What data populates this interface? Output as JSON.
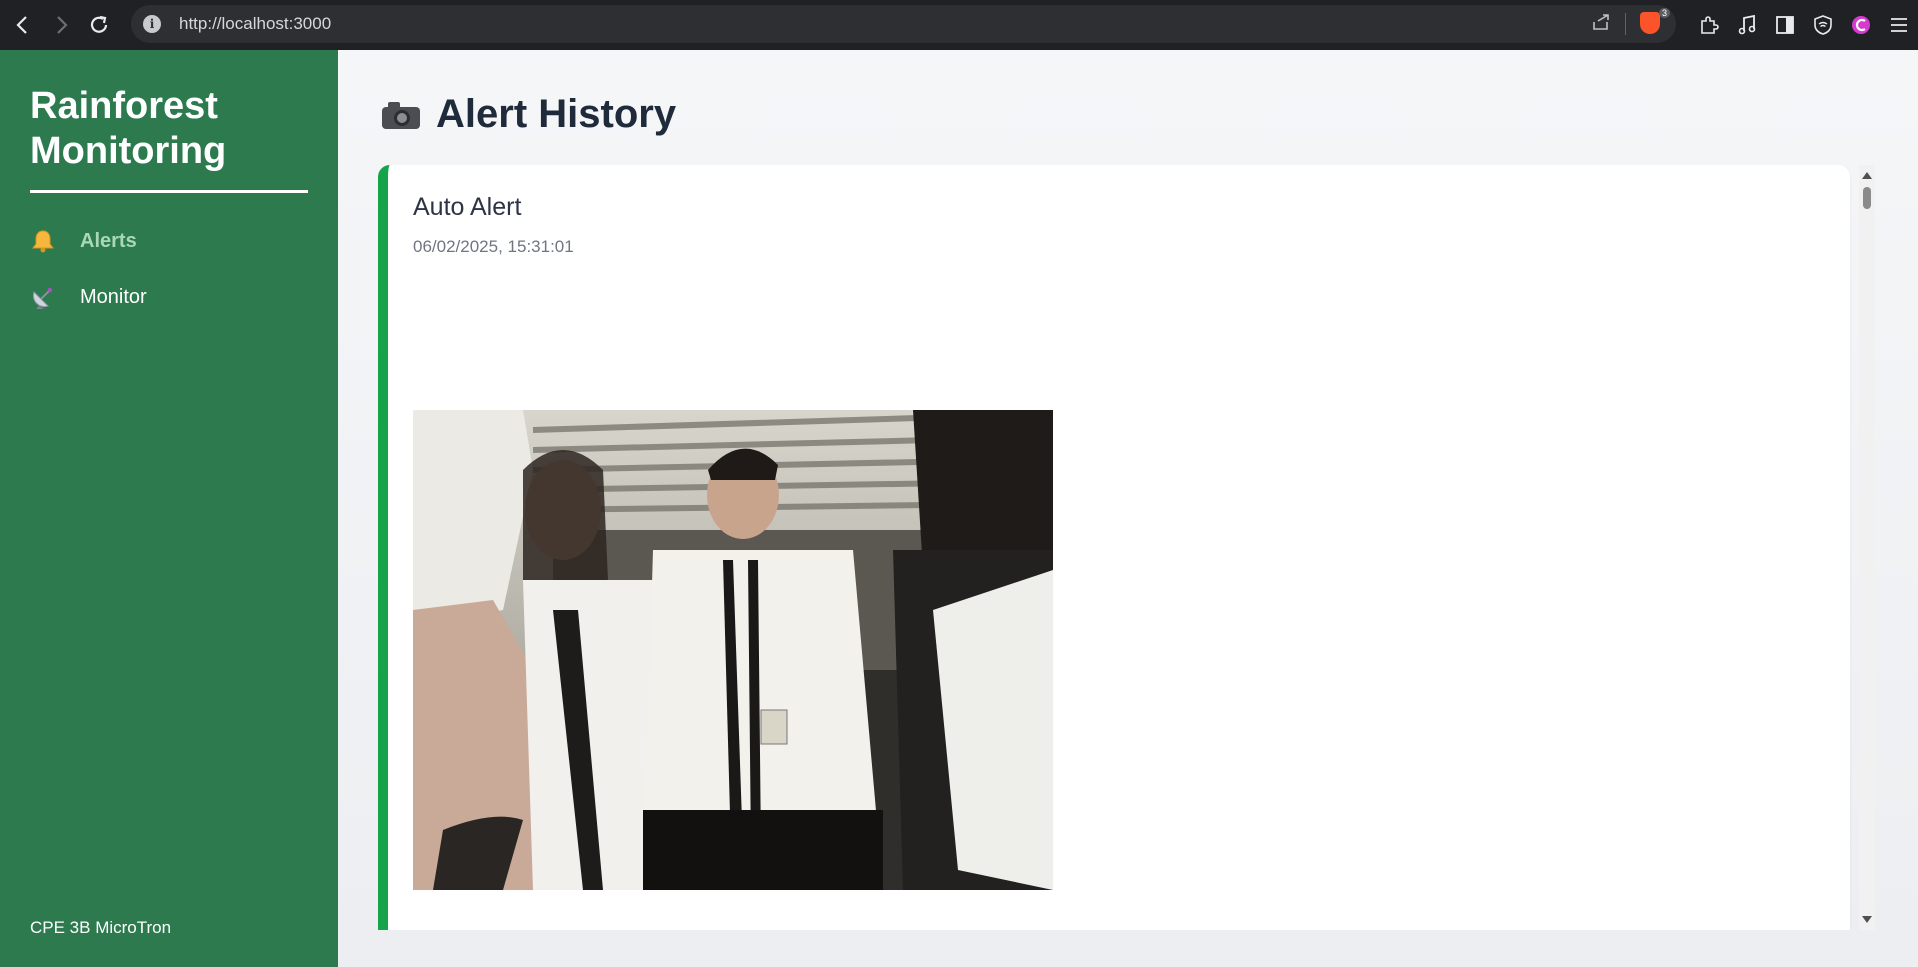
{
  "browser": {
    "url": "http://localhost:3000",
    "info_icon": "i",
    "extension_badge_count": "3"
  },
  "sidebar": {
    "brand": "Rainforest Monitoring",
    "items": [
      {
        "label": "Alerts",
        "icon": "bell-icon",
        "active": true
      },
      {
        "label": "Monitor",
        "icon": "satellite-dish-icon",
        "active": false
      }
    ],
    "footer": "CPE 3B MicroTron"
  },
  "main": {
    "title_icon": "camera-icon",
    "title": "Alert History",
    "alerts": [
      {
        "title": "Auto Alert",
        "timestamp": "06/02/2025, 15:31:01",
        "image": "camera-snapshot-photo"
      }
    ]
  },
  "colors": {
    "sidebar_bg": "#2d7a4f",
    "accent_green": "#17a34a",
    "active_nav_text": "#a9d8b5",
    "title_text": "#1f2a3a"
  }
}
